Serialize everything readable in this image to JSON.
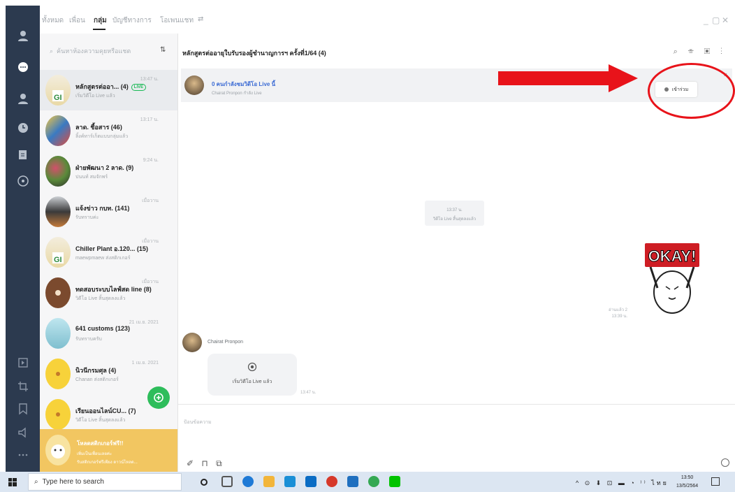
{
  "window": {
    "tabs": [
      "ทั้งหมด",
      "เพื่อน",
      "กลุ่ม",
      "บัญชีทางการ",
      "โอเพนแชท"
    ],
    "active_tab": "กลุ่ม",
    "filter_icon": "filter-icon",
    "controls": [
      "_",
      "▢",
      "✕"
    ]
  },
  "rail": {
    "icons": [
      "person-icon",
      "chat-bubble-icon",
      "friends-icon",
      "clock-icon",
      "note-add-icon",
      "openchat-icon",
      "keep-icon",
      "crop-icon",
      "bookmark-icon",
      "speaker-icon",
      "more-icon"
    ]
  },
  "list": {
    "search_placeholder": "ค้นหาห้องความคุยหรือแชต",
    "sort_icon": "⇅",
    "chats": [
      {
        "name": "หลักสูตรต่ออา... (4)",
        "live": "LIVE",
        "sub": "เริ่มวิดีโอ Live แล้ว",
        "time": "13:47 น."
      },
      {
        "name": "ลาด. ชี้อสาร (46)",
        "sub": "ลิ้งค์ทาร์เก็ตแบบกลุ่มแล้ว",
        "time": "13:17 น."
      },
      {
        "name": "ฝ่ายพัฒนา 2 ลาด. (9)",
        "sub": "ปนนท์ สมจักพร์",
        "time": "9:24 น."
      },
      {
        "name": "แจ้งข่าว กบท. (141)",
        "sub": "รับทราบค่ะ",
        "time": "เมื่อวาน"
      },
      {
        "name": "Chiller Plant อ.120... (15)",
        "sub": "maewpmaew ส่งสติกเกอร์",
        "time": "เมื่อวาน"
      },
      {
        "name": "ทดสอบระบบไลฟ์สด line (8)",
        "sub": "วิดีโอ Live สิ้นสุดลงแล้ว",
        "time": "เมื่อวาน"
      },
      {
        "name": "641 customs (123)",
        "sub": "รับทราบครับ",
        "time": "21 เม.ย. 2021"
      },
      {
        "name": "นิวนีกรมศุล (4)",
        "sub": "Chanan ส่งสติกเกอร์",
        "time": "1 เม.ย. 2021"
      },
      {
        "name": "เรียนออนไลน์CU... (7)",
        "sub": "วิดีโอ Live สิ้นสุดลงแล้ว",
        "time": ""
      }
    ],
    "fab_icon": "new-chat-icon",
    "promo": {
      "title": "โหลดสติกเกอร์ฟรี!!",
      "sub1": "เพิ่มเป็นเพื่อนเลยค่ะ",
      "sub2": "รับสติกเกอร์ฟรีเพียง ดาวน์โหลด..."
    }
  },
  "chat": {
    "title": "หลักสูตรต่ออายุใบรับรองผู้ชำนาญการฯ ครั้งที่1/64 (4)",
    "header_icons": "⌕ ☏ ▣ ⋮",
    "banner": {
      "title_hl": "0 คนกำลังชมวิดีโอ Live นี้",
      "title_rest": "",
      "sub": "Chairat Pronpon กำลัง Live",
      "join_label": "เข้าร่วม",
      "close": "×"
    },
    "system_msg": {
      "time": "13:37 น.",
      "text": "วิดีโอ Live สิ้นสุดลงแล้ว"
    },
    "read_meta": {
      "read": "อ่านแล้ว 2",
      "time": "13:39 น."
    },
    "sticker_text": "OKAY!",
    "sender": "Chairat Pronpon",
    "live_bubble_text": "เริ่มวิดีโอ Live แล้ว",
    "live_bubble_time": "13:47 น.",
    "input_placeholder": "ป้อนข้อความ",
    "input_icons": "✐ ⊓ ⧉"
  },
  "taskbar": {
    "search_placeholder": "Type here to search",
    "tray": "^ ⊙ ⬇ ⊡ ▬ ◔ ⁾⁾ ไทย",
    "time": "13:50",
    "date": "13/5/2564"
  },
  "colors": {
    "rail": "#2c3a4f",
    "line_green": "#2ebd5b",
    "annotation_red": "#e8131a",
    "taskbar": "#dce6f2"
  }
}
